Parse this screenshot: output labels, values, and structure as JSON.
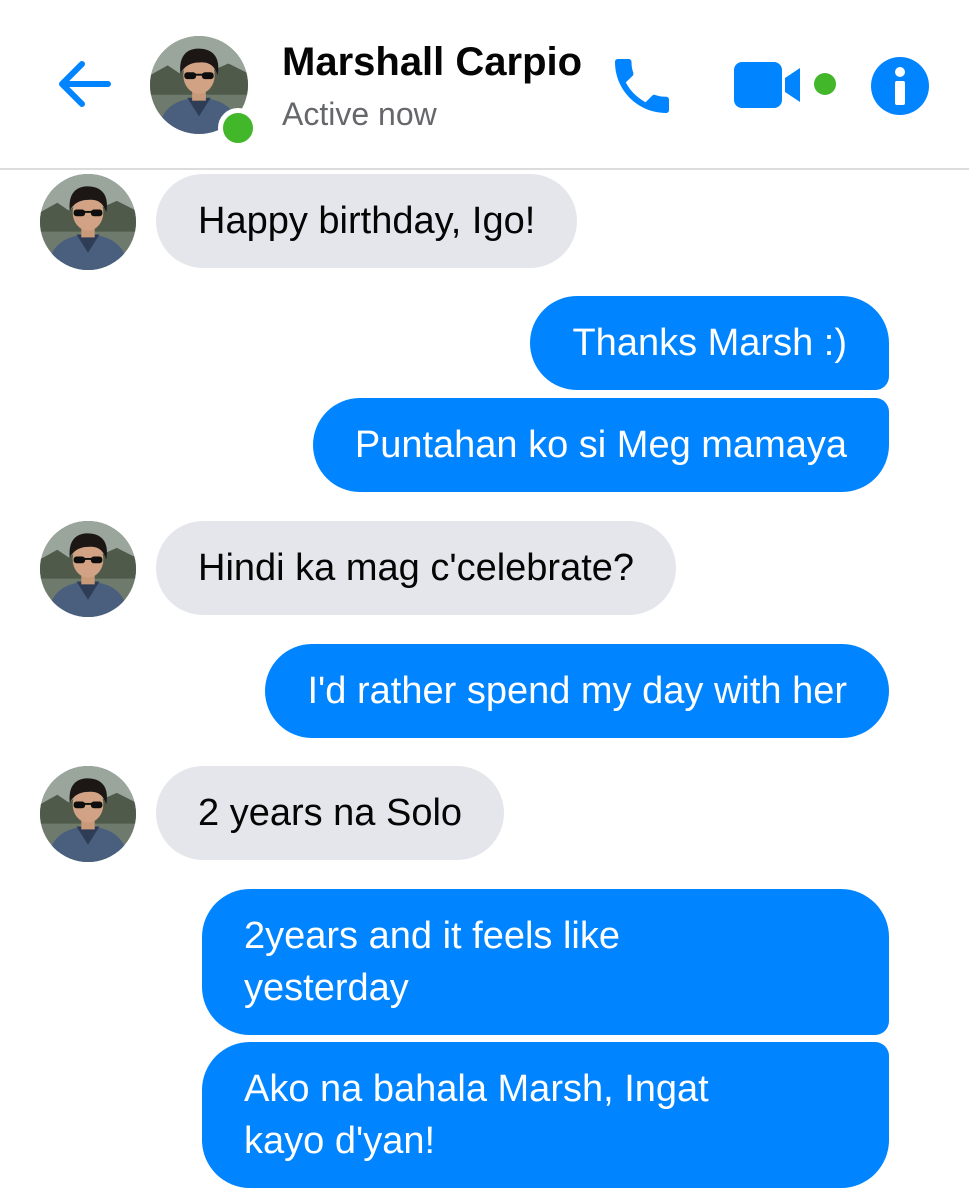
{
  "header": {
    "contact_name": "Marshall Carpio",
    "contact_status": "Active now",
    "back_icon": "arrow-left-icon",
    "call_icon": "phone-icon",
    "video_icon": "video-camera-icon",
    "info_icon": "info-icon",
    "accent_color": "#0084ff",
    "presence_color": "#42b72a"
  },
  "messages": [
    {
      "sender": "Marshall Carpio",
      "direction": "incoming",
      "text": "Happy birthday, Igo!"
    },
    {
      "sender": "me",
      "direction": "outgoing",
      "text": "Thanks Marsh :)"
    },
    {
      "sender": "me",
      "direction": "outgoing",
      "text": "Puntahan ko si Meg mamaya"
    },
    {
      "sender": "Marshall Carpio",
      "direction": "incoming",
      "text": "Hindi ka mag c'celebrate?"
    },
    {
      "sender": "me",
      "direction": "outgoing",
      "text": "I'd rather spend my day with her"
    },
    {
      "sender": "Marshall Carpio",
      "direction": "incoming",
      "text": "2 years na Solo"
    },
    {
      "sender": "me",
      "direction": "outgoing",
      "text_lines": [
        "2years and it feels like",
        "yesterday"
      ]
    },
    {
      "sender": "me",
      "direction": "outgoing",
      "text_lines": [
        "Ako na bahala Marsh, Ingat",
        "kayo d'yan!"
      ]
    }
  ],
  "colors": {
    "incoming_bubble": "#e4e6eb",
    "outgoing_bubble": "#0084ff",
    "secondary_text": "#65676b"
  }
}
